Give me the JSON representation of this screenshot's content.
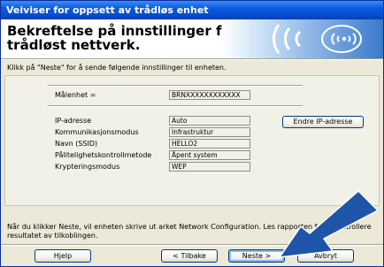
{
  "window": {
    "title": "Veiviser for oppsett av trådløs enhet"
  },
  "header": {
    "title": "Bekreftelse på innstillinger for trådløst nettverk."
  },
  "intro": "Klikk på \"Neste\" for å sende følgende innstillinger til enheten.",
  "target": {
    "label": "Målenhet =",
    "value": "BRNXXXXXXXXXXXX"
  },
  "settings": [
    {
      "label": "IP-adresse",
      "value": "Auto"
    },
    {
      "label": "Kommunikasjonsmodus",
      "value": "Infrastruktur"
    },
    {
      "label": "Navn (SSID)",
      "value": "HELLO2"
    },
    {
      "label": "Pålitelighetskontrollmetode",
      "value": "Åpent system"
    },
    {
      "label": "Krypteringsmodus",
      "value": "WEP"
    }
  ],
  "change_ip_button": "Endre IP-adresse",
  "note": "Når du klikker Neste, vil enheten skrive ut arket Network Configuration. Les rapporten for å kontrollere resultatet av tilkoblingen.",
  "buttons": {
    "help": "Hjelp",
    "back": "< Tilbake",
    "next": "Neste >",
    "cancel": "Avbryt"
  },
  "colors": {
    "titlebar": "#0a4fd0",
    "arrow": "#1f55a8",
    "accent": "#3b79cc"
  }
}
